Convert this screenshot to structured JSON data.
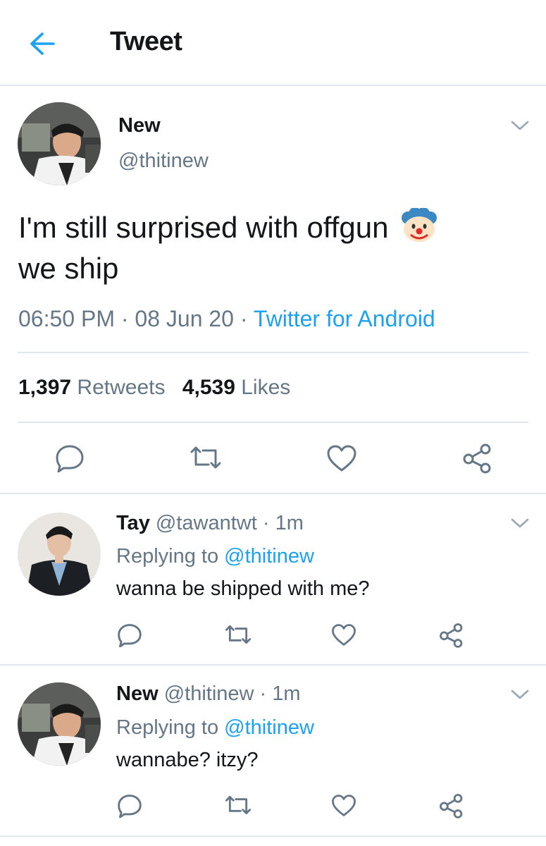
{
  "header": {
    "title": "Tweet"
  },
  "main_tweet": {
    "author_name": "New",
    "author_handle": "@thitinew",
    "text_line1": "I'm still surprised with offgun",
    "emoji": "clown-face",
    "text_line2": "we ship",
    "time": "06:50 PM",
    "sep1": "·",
    "date": "08 Jun 20",
    "sep2": "·",
    "source": "Twitter for Android",
    "retweets_count": "1,397",
    "retweets_label": "Retweets",
    "likes_count": "4,539",
    "likes_label": "Likes"
  },
  "replies": [
    {
      "author_name": "Tay",
      "author_handle": "@tawantwt",
      "sep": "·",
      "age": "1m",
      "replying_prefix": "Replying to",
      "replying_handle": "@thitinew",
      "text": "wanna be shipped with me?"
    },
    {
      "author_name": "New",
      "author_handle": "@thitinew",
      "sep": "·",
      "age": "1m",
      "replying_prefix": "Replying to",
      "replying_handle": "@thitinew",
      "text": "wannabe? itzy?"
    }
  ],
  "icons": [
    "back-arrow-icon",
    "chevron-down-icon",
    "reply-icon",
    "retweet-icon",
    "like-icon",
    "share-icon"
  ],
  "colors": {
    "accent": "#1da1f2",
    "text": "#14171a",
    "muted": "#657786",
    "divider": "#e1e8ed"
  }
}
